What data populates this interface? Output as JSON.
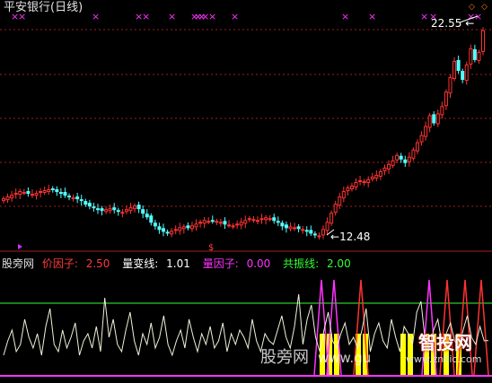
{
  "header": {
    "stock_title": "平安银行(日线)"
  },
  "price_panel": {
    "high_label": "22.55",
    "low_label": "12.48",
    "arrow_high": "←",
    "arrow_low": "←"
  },
  "indicator_panel": {
    "site_label": "股旁网",
    "items": [
      {
        "label": "价因子:",
        "value": "2.50",
        "color": "#ff3b3b"
      },
      {
        "label": "量变线:",
        "value": "1.01",
        "color": "#ffffff"
      },
      {
        "label": "量因子:",
        "value": "0.00",
        "color": "#ff33ff"
      },
      {
        "label": "共振线:",
        "value": "2.00",
        "color": "#33ff33"
      }
    ]
  },
  "watermarks": {
    "left": "股旁网",
    "middle": "www.gu",
    "right": "智投网",
    "url": "www.znilic.com"
  },
  "colors": {
    "up": "#ff3232",
    "down": "#54ffff",
    "white": "#ffffff",
    "magenta": "#ff33ff",
    "green": "#33ff33",
    "yellow": "#ffff00",
    "grid": "#a0201e"
  },
  "chart_data": [
    {
      "type": "candlestick",
      "title": "平安银行(日线)",
      "close": [
        12.9,
        13.0,
        13.1,
        13.2,
        13.3,
        13.25,
        13.2,
        13.15,
        13.2,
        13.3,
        13.35,
        13.4,
        13.45,
        13.3,
        13.2,
        13.1,
        13.0,
        12.95,
        12.9,
        12.8,
        12.6,
        12.5,
        12.4,
        12.3,
        12.25,
        12.3,
        12.35,
        12.3,
        12.2,
        12.15,
        12.3,
        12.4,
        12.5,
        12.35,
        12.1,
        11.9,
        11.6,
        11.4,
        11.2,
        11.1,
        11.0,
        11.1,
        11.2,
        11.3,
        11.35,
        11.3,
        11.4,
        11.5,
        11.6,
        11.7,
        11.65,
        11.7,
        11.65,
        11.6,
        11.5,
        11.45,
        11.4,
        11.5,
        11.6,
        11.7,
        11.8,
        11.75,
        11.7,
        11.8,
        11.85,
        11.8,
        11.7,
        11.6,
        11.4,
        11.3,
        11.35,
        11.3,
        11.25,
        11.2,
        11.1,
        11.0,
        10.9,
        10.85,
        11.2,
        11.6,
        12.1,
        12.6,
        13.0,
        13.3,
        13.5,
        13.6,
        13.8,
        13.9,
        13.85,
        13.95,
        14.1,
        14.2,
        14.4,
        14.6,
        14.8,
        15.0,
        15.3,
        15.1,
        14.9,
        15.2,
        15.6,
        16.0,
        16.4,
        16.9,
        17.5,
        17.1,
        17.6,
        18.0,
        18.8,
        19.6,
        20.5,
        20.0,
        19.5,
        20.3,
        21.2,
        20.6,
        21.0,
        22.2
      ],
      "markers": {
        "high": 22.55,
        "low": 12.48
      },
      "ylim": [
        10.4,
        23.3
      ]
    },
    {
      "type": "line",
      "title": "股旁网",
      "series": [
        {
          "name": "价因子",
          "value": 2.5
        },
        {
          "name": "量变线",
          "value": 1.01,
          "values": [
            0.6,
            1.0,
            1.3,
            0.7,
            0.9,
            1.6,
            1.1,
            0.8,
            1.2,
            0.6,
            1.4,
            1.9,
            0.9,
            0.7,
            1.3,
            0.8,
            1.1,
            1.5,
            0.6,
            1.0,
            1.2,
            0.8,
            1.4,
            0.7,
            2.2,
            1.1,
            1.6,
            0.9,
            0.7,
            1.3,
            1.8,
            1.0,
            0.6,
            1.2,
            0.9,
            1.5,
            0.8,
            1.1,
            1.7,
            0.9,
            0.6,
            1.0,
            1.3,
            0.8,
            1.6,
            1.1,
            0.7,
            1.2,
            0.9,
            1.4,
            0.8,
            1.0,
            1.5,
            0.7,
            1.2,
            0.9,
            1.3,
            1.1,
            0.8,
            1.6,
            1.0,
            0.7,
            1.2,
            1.0,
            0.9,
            1.3,
            1.7,
            1.1,
            0.8,
            1.4,
            2.3,
            0.9,
            1.6,
            2.0,
            1.1,
            0.7,
            1.3,
            1.8,
            1.0,
            0.8,
            1.2,
            1.5,
            0.9,
            1.1,
            0.8,
            1.3,
            1.9,
            0.7,
            1.2,
            1.5,
            1.0,
            0.8,
            1.6,
            1.1,
            0.7,
            1.4,
            1.2,
            0.9,
            1.8,
            2.1,
            1.0,
            0.8,
            1.3,
            1.6,
            0.9,
            1.2,
            1.5,
            1.0,
            0.8,
            1.3,
            1.7,
            1.1,
            0.9,
            1.4,
            1.0,
            1.01
          ]
        },
        {
          "name": "量因子",
          "value": 0.0
        },
        {
          "name": "共振线",
          "value": 2.0
        }
      ],
      "ylim": [
        0,
        3.0
      ]
    }
  ]
}
